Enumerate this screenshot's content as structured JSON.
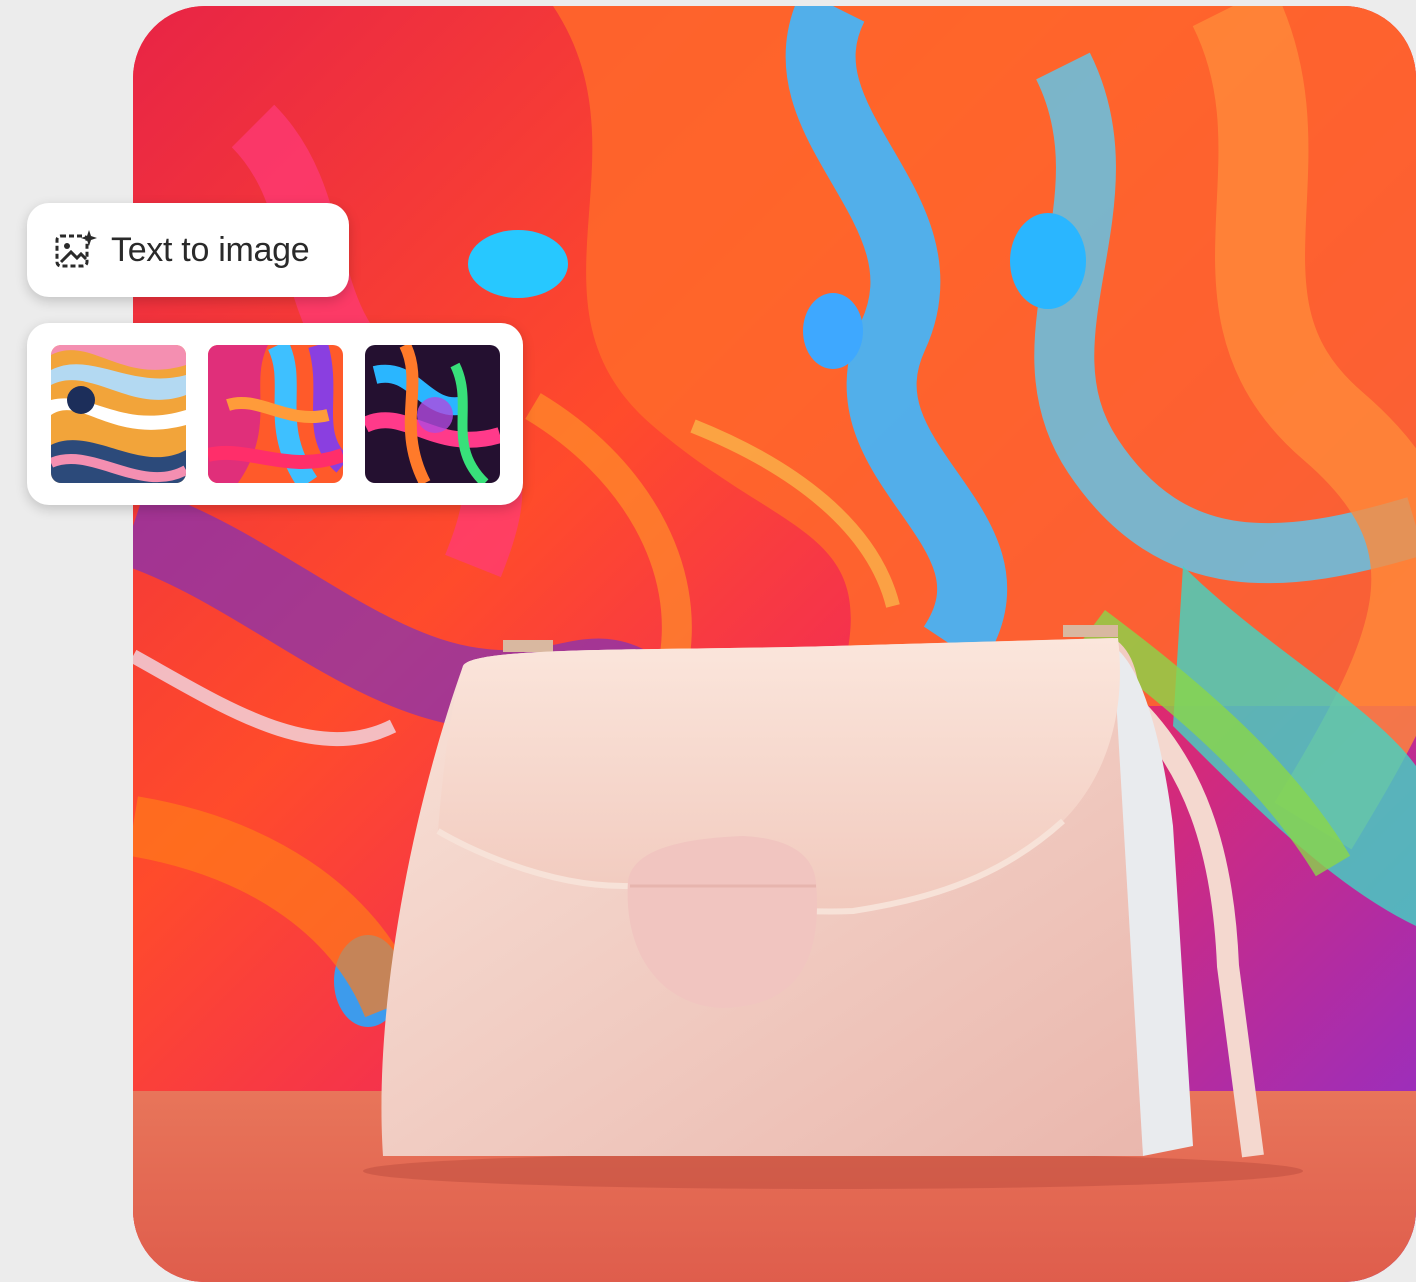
{
  "chip": {
    "label": "Text to image",
    "icon": "text-to-image-sparkle-icon"
  },
  "thumbnails": [
    {
      "name": "thumbnail-pastel-waves",
      "selected": false
    },
    {
      "name": "thumbnail-vivid-fluid",
      "selected": false
    },
    {
      "name": "thumbnail-dark-neon-fluid",
      "selected": false
    }
  ],
  "colors": {
    "background": "#ececec",
    "panel": "#ffffff",
    "text": "#2a2a2a"
  }
}
